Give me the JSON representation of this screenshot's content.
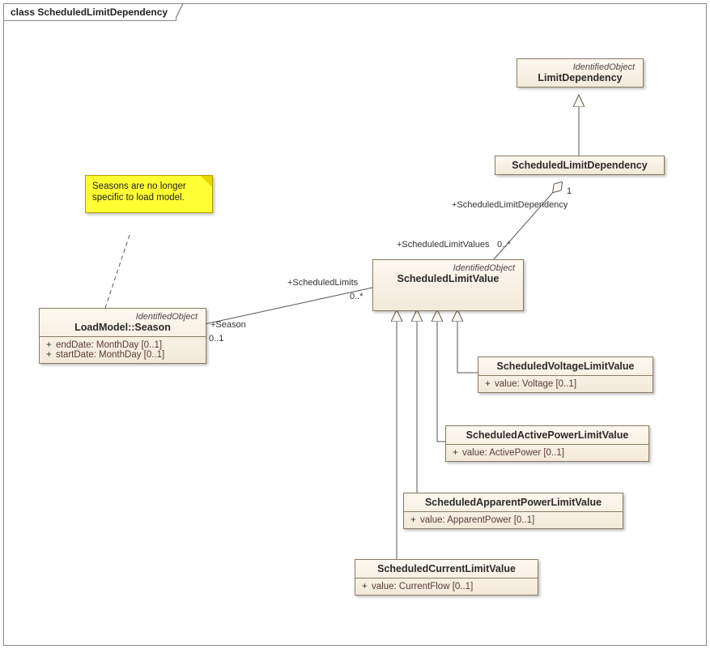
{
  "diagram_title": "class ScheduledLimitDependency",
  "note": {
    "text": "Seasons are no longer specific to load model."
  },
  "classes": {
    "limitDependency": {
      "stereotype": "IdentifiedObject",
      "name": "LimitDependency"
    },
    "schedLimitDep": {
      "name": "ScheduledLimitDependency"
    },
    "schedLimitValue": {
      "stereotype": "IdentifiedObject",
      "name": "ScheduledLimitValue"
    },
    "season": {
      "stereotype": "IdentifiedObject",
      "name": "LoadModel::Season",
      "attrs": [
        "endDate: MonthDay [0..1]",
        "startDate: MonthDay [0..1]"
      ]
    },
    "voltage": {
      "name": "ScheduledVoltageLimitValue",
      "attr": "value: Voltage [0..1]"
    },
    "active": {
      "name": "ScheduledActivePowerLimitValue",
      "attr": "value: ActivePower [0..1]"
    },
    "apparent": {
      "name": "ScheduledApparentPowerLimitValue",
      "attr": "value: ApparentPower [0..1]"
    },
    "current": {
      "name": "ScheduledCurrentLimitValue",
      "attr": "value: CurrentFlow [0..1]"
    }
  },
  "edge_labels": {
    "sld_role": "+ScheduledLimitDependency",
    "sld_mult": "1",
    "slv_role": "+ScheduledLimitValues",
    "slv_mult": "0..*",
    "season_role": "+Season",
    "season_mult": "0..1",
    "limits_role": "+ScheduledLimits",
    "limits_mult": "0..*"
  },
  "chart_data": {
    "type": "uml_class_diagram",
    "title": "ScheduledLimitDependency",
    "classes": [
      {
        "id": "LimitDependency",
        "stereotype": "IdentifiedObject"
      },
      {
        "id": "ScheduledLimitDependency"
      },
      {
        "id": "ScheduledLimitValue",
        "stereotype": "IdentifiedObject"
      },
      {
        "id": "LoadModel::Season",
        "stereotype": "IdentifiedObject",
        "attributes": [
          "+ endDate: MonthDay [0..1]",
          "+ startDate: MonthDay [0..1]"
        ]
      },
      {
        "id": "ScheduledVoltageLimitValue",
        "attributes": [
          "+ value: Voltage [0..1]"
        ]
      },
      {
        "id": "ScheduledActivePowerLimitValue",
        "attributes": [
          "+ value: ActivePower [0..1]"
        ]
      },
      {
        "id": "ScheduledApparentPowerLimitValue",
        "attributes": [
          "+ value: ApparentPower [0..1]"
        ]
      },
      {
        "id": "ScheduledCurrentLimitValue",
        "attributes": [
          "+ value: CurrentFlow [0..1]"
        ]
      }
    ],
    "relationships": [
      {
        "type": "generalization",
        "child": "ScheduledLimitDependency",
        "parent": "LimitDependency"
      },
      {
        "type": "generalization",
        "child": "ScheduledVoltageLimitValue",
        "parent": "ScheduledLimitValue"
      },
      {
        "type": "generalization",
        "child": "ScheduledActivePowerLimitValue",
        "parent": "ScheduledLimitValue"
      },
      {
        "type": "generalization",
        "child": "ScheduledApparentPowerLimitValue",
        "parent": "ScheduledLimitValue"
      },
      {
        "type": "generalization",
        "child": "ScheduledCurrentLimitValue",
        "parent": "ScheduledLimitValue"
      },
      {
        "type": "aggregation",
        "whole": "ScheduledLimitDependency",
        "part": "ScheduledLimitValue",
        "whole_role": "+ScheduledLimitDependency",
        "whole_mult": "1",
        "part_role": "+ScheduledLimitValues",
        "part_mult": "0..*"
      },
      {
        "type": "association",
        "a": "LoadModel::Season",
        "b": "ScheduledLimitValue",
        "a_role": "+Season",
        "a_mult": "0..1",
        "b_role": "+ScheduledLimits",
        "b_mult": "0..*"
      },
      {
        "type": "note_link",
        "note": "Seasons are no longer specific to load model.",
        "target": "LoadModel::Season"
      }
    ]
  }
}
